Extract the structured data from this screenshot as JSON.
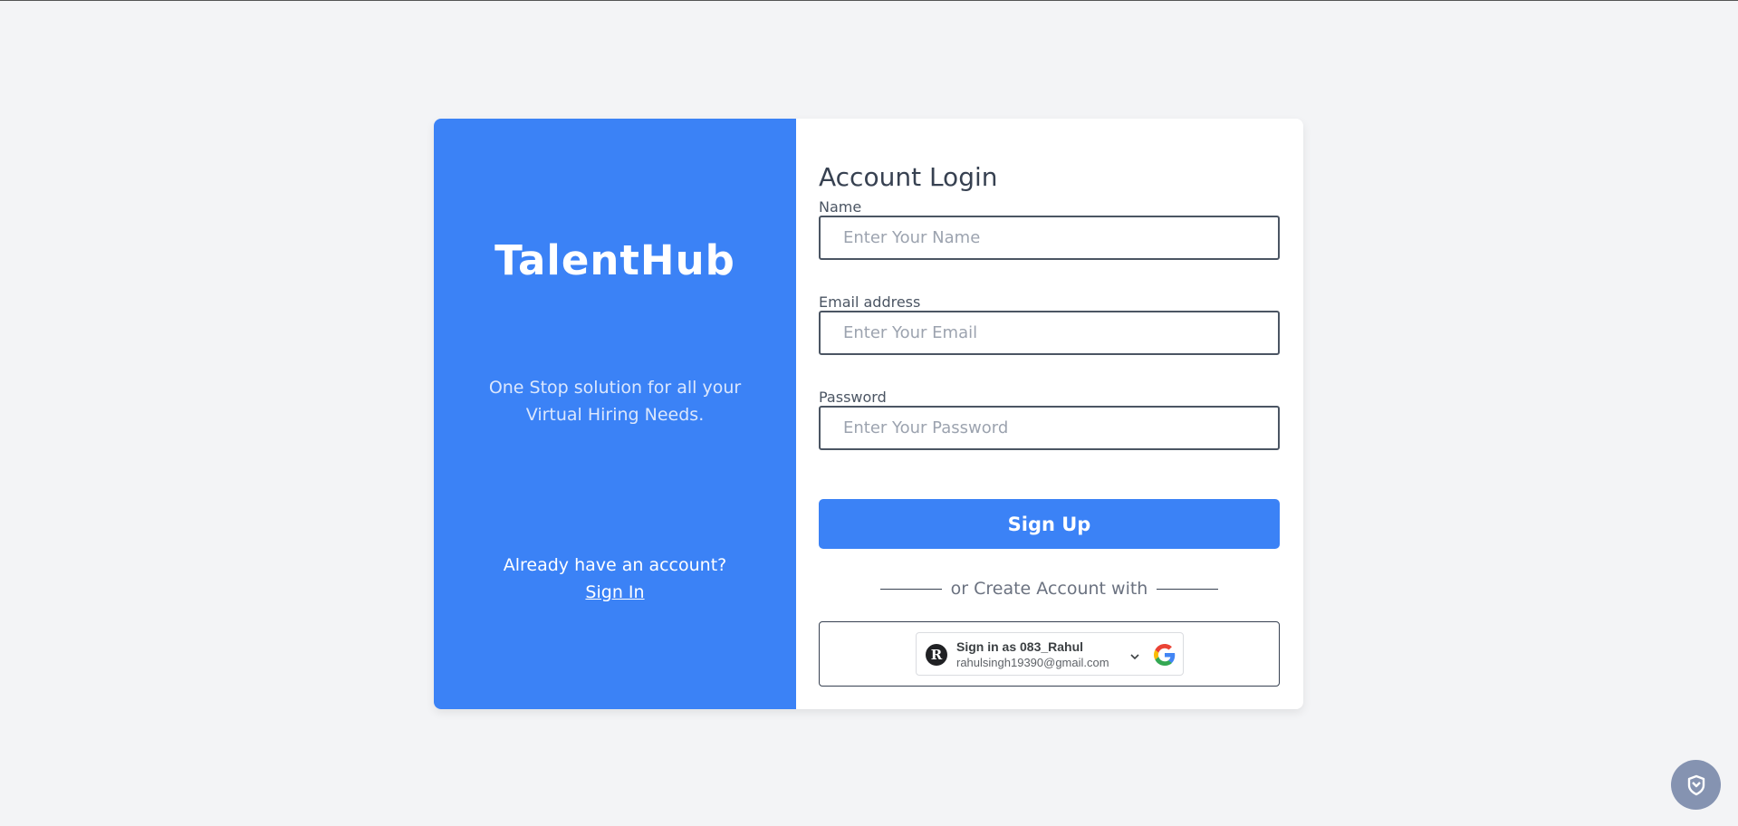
{
  "brand": {
    "name": "TalentHub",
    "tagline": "One Stop solution for all your Virtual Hiring Needs.",
    "already_text": "Already have an account?",
    "signin_label": "Sign In"
  },
  "form": {
    "title": "Account Login",
    "name_label": "Name",
    "name_placeholder": "Enter Your Name",
    "email_label": "Email address",
    "email_placeholder": "Enter Your Email",
    "password_label": "Password",
    "password_placeholder": "Enter Your Password",
    "submit_label": "Sign Up",
    "divider_text": "or Create Account with"
  },
  "google": {
    "avatar_letter": "R",
    "signin_as": "Sign in as 083_Rahul",
    "email": "rahulsingh19390@gmail.com",
    "icon": "google-g-icon"
  },
  "colors": {
    "accent": "#3b82f6",
    "page_bg": "#f3f4f6",
    "float_button": "#8593b1"
  },
  "icons": {
    "floating": "shield-icon",
    "dropdown": "chevron-down-icon"
  }
}
